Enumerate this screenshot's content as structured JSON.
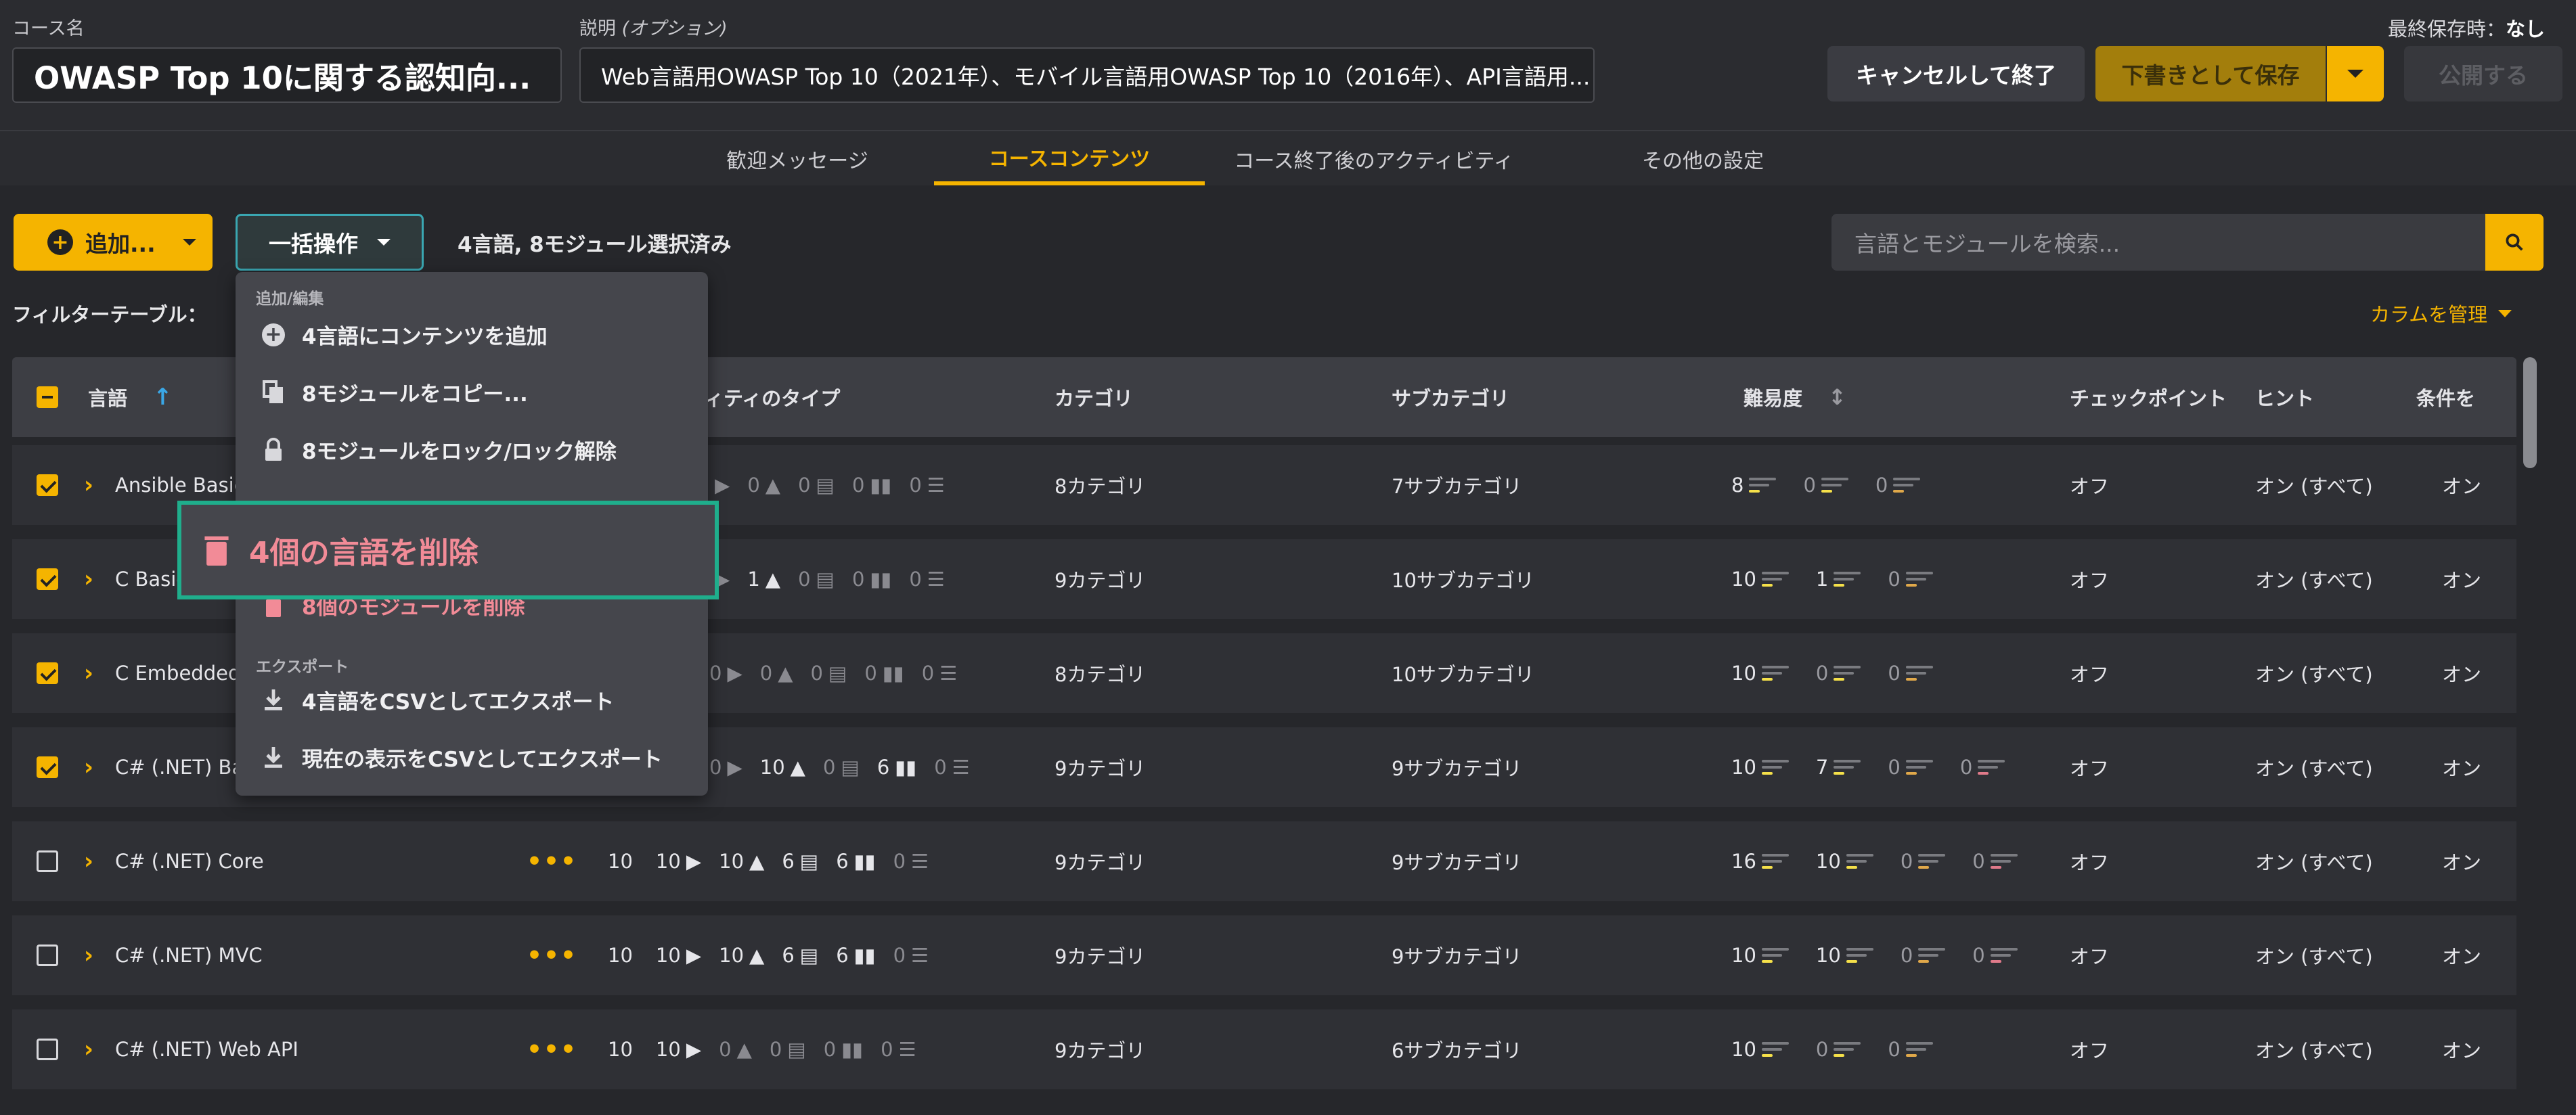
{
  "header": {
    "course_name_label": "コース名",
    "course_name_value": "OWASP Top 10に関する認知向...",
    "description_label_main": "説明",
    "description_label_opt": "(オプション)",
    "description_value": "Web言語用OWASP Top 10（2021年）、モバイル言語用OWASP Top 10（2016年）、API言語用...",
    "cancel_button": "キャンセルして終了",
    "save_draft_button": "下書きとして保存",
    "publish_button": "公開する",
    "last_saved_label": "最終保存時：",
    "last_saved_value": "なし"
  },
  "tabs": [
    "歓迎メッセージ",
    "コースコンテンツ",
    "コース終了後のアクティビティ",
    "その他の設定"
  ],
  "toolbar": {
    "add_button": "追加...",
    "bulk_button": "一括操作",
    "selection_status": "4言語, 8モジュール選択済み",
    "search_placeholder": "言語とモジュールを検索...",
    "filter_label": "フィルターテーブル：",
    "manage_columns": "カラムを管理"
  },
  "table": {
    "headers": {
      "language": "言語",
      "activity_type_partial": "ィティのタイプ",
      "category": "カテゴリ",
      "subcategory": "サブカテゴリ",
      "difficulty": "難易度",
      "checkpoint": "チェックポイント",
      "hint": "ヒント",
      "conditions": "条件を"
    },
    "rows": [
      {
        "checked": true,
        "name": "Ansible Basic",
        "types": [
          "",
          "0",
          "0",
          "0",
          "0"
        ],
        "category": "8カテゴリ",
        "subcategory": "7サブカテゴリ",
        "difficulty": [
          "8",
          "0",
          "0"
        ],
        "checkpoint": "オフ",
        "hint": "オン (すべて)",
        "cond": "オン"
      },
      {
        "checked": true,
        "name": "C Basic",
        "types": [
          "",
          "1",
          "0",
          "0",
          "0"
        ],
        "category": "9カテゴリ",
        "subcategory": "10サブカテゴリ",
        "difficulty": [
          "10",
          "1",
          "0"
        ],
        "checkpoint": "オフ",
        "hint": "オン (すべて)",
        "cond": "オン"
      },
      {
        "checked": true,
        "name": "C Embedded",
        "types": [
          "0",
          "0",
          "0",
          "0",
          "0"
        ],
        "category": "8カテゴリ",
        "subcategory": "10サブカテゴリ",
        "difficulty": [
          "10",
          "0",
          "0"
        ],
        "checkpoint": "オフ",
        "hint": "オン (すべて)",
        "cond": "オン"
      },
      {
        "checked": true,
        "name": "C# (.NET) Bas",
        "types": [
          "0",
          "10",
          "0",
          "6",
          "0"
        ],
        "category": "9カテゴリ",
        "subcategory": "9サブカテゴリ",
        "difficulty": [
          "10",
          "7",
          "0",
          "0"
        ],
        "checkpoint": "オフ",
        "hint": "オン (すべて)",
        "cond": "オン"
      },
      {
        "checked": false,
        "name": "C# (.NET) Core",
        "types": [
          "10",
          "10",
          "10",
          "6",
          "6",
          "0"
        ],
        "category": "9カテゴリ",
        "subcategory": "9サブカテゴリ",
        "difficulty": [
          "16",
          "10",
          "0",
          "0"
        ],
        "checkpoint": "オフ",
        "hint": "オン (すべて)",
        "cond": "オン"
      },
      {
        "checked": false,
        "name": "C# (.NET) MVC",
        "types": [
          "10",
          "10",
          "10",
          "6",
          "6",
          "0"
        ],
        "category": "9カテゴリ",
        "subcategory": "9サブカテゴリ",
        "difficulty": [
          "10",
          "10",
          "0",
          "0"
        ],
        "checkpoint": "オフ",
        "hint": "オン (すべて)",
        "cond": "オン"
      },
      {
        "checked": false,
        "name": "C# (.NET) Web API",
        "types": [
          "10",
          "10",
          "0",
          "0",
          "0",
          "0"
        ],
        "category": "9カテゴリ",
        "subcategory": "6サブカテゴリ",
        "difficulty": [
          "10",
          "0",
          "0"
        ],
        "checkpoint": "オフ",
        "hint": "オン (すべて)",
        "cond": "オン"
      }
    ]
  },
  "menu": {
    "section_edit": "追加/編集",
    "add_content": "4言語にコンテンツを追加",
    "copy_modules": "8モジュールをコピー...",
    "lock_modules": "8モジュールをロック/ロック解除",
    "delete_languages": "4個の言語を削除",
    "delete_modules": "8個のモジュールを削除",
    "section_export": "エクスポート",
    "export_csv": "4言語をCSVとしてエクスポート",
    "export_view": "現在の表示をCSVとしてエクスポート"
  },
  "colors": {
    "accent": "#f5b400",
    "danger": "#f28b97",
    "highlight": "#1fae8c"
  }
}
